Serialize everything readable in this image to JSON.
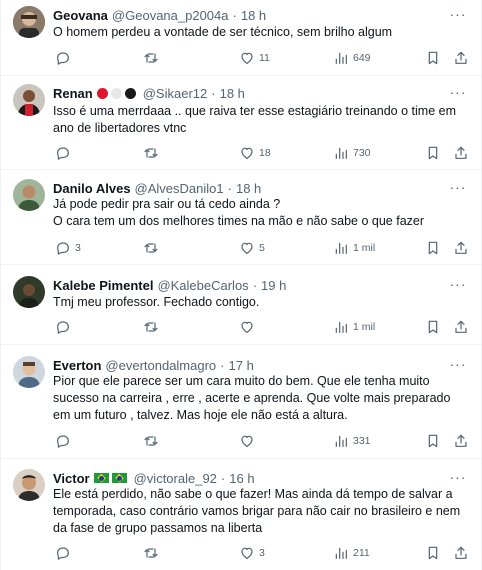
{
  "tweets": [
    {
      "name": "Geovana",
      "handle": "@Geovana_p2004a",
      "time": "18 h",
      "text": [
        "O homem perdeu a vontade de ser técnico, sem brilho algum"
      ],
      "replies": "",
      "retweets": "",
      "likes": "11",
      "views": "649",
      "badges": []
    },
    {
      "name": "Renan",
      "handle": "@Sikaer12",
      "time": "18 h",
      "text": [
        "Isso é uma merrdaaa .. que raiva ter esse estagiário treinando o time em ano de libertadores vtnc"
      ],
      "replies": "",
      "retweets": "",
      "likes": "18",
      "views": "730",
      "badges": [
        "#e0142d",
        "#e8e8e8",
        "#1a1a1a"
      ]
    },
    {
      "name": "Danilo Alves",
      "handle": "@AlvesDanilo1",
      "time": "18 h",
      "text": [
        "Já pode pedir pra sair ou tá cedo ainda ?",
        "O cara tem um dos melhores times na mão e não sabe o que fazer"
      ],
      "replies": "3",
      "retweets": "",
      "likes": "5",
      "views": "1 mil",
      "badges": []
    },
    {
      "name": "Kalebe Pimentel",
      "handle": "@KalebeCarlos",
      "time": "19 h",
      "text": [
        "Tmj meu professor. Fechado contigo."
      ],
      "replies": "",
      "retweets": "",
      "likes": "",
      "views": "1 mil",
      "badges": []
    },
    {
      "name": "Everton",
      "handle": "@evertondalmagro",
      "time": "17 h",
      "text": [
        "Pior que ele parece ser um cara muito do bem. Que ele tenha muito sucesso na carreira , erre , acerte e aprenda. Que volte mais preparado em um futuro , talvez. Mas hoje ele não está a altura."
      ],
      "replies": "",
      "retweets": "",
      "likes": "",
      "views": "331",
      "badges": []
    },
    {
      "name": "Victor",
      "handle": "@victorale_92",
      "time": "16 h",
      "text": [
        "Ele está perdido, não sabe o que fazer! Mas ainda dá tempo de salvar a temporada, caso contrário vamos brigar para não cair no brasileiro e nem da fase de grupo passamos na liberta"
      ],
      "replies": "",
      "retweets": "",
      "likes": "3",
      "views": "211",
      "badges": [
        "flag-br",
        "flag-br"
      ]
    }
  ],
  "icons": {
    "reply": "reply-icon",
    "retweet": "retweet-icon",
    "like": "heart-icon",
    "views": "views-icon",
    "bookmark": "bookmark-icon",
    "share": "share-icon",
    "more": "more-icon"
  },
  "colors": {
    "text": "#0f1419",
    "secondary": "#536471",
    "divider": "#eff3f4"
  }
}
